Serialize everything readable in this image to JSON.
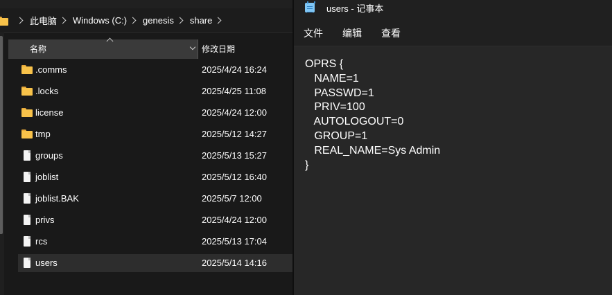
{
  "explorer": {
    "breadcrumb": [
      "此电脑",
      "Windows (C:)",
      "genesis",
      "share"
    ],
    "columns": {
      "name": "名称",
      "date": "修改日期"
    },
    "items": [
      {
        "name": ".comms",
        "date": "2025/4/24 16:24",
        "type": "folder"
      },
      {
        "name": ".locks",
        "date": "2025/4/25 11:08",
        "type": "folder"
      },
      {
        "name": "license",
        "date": "2025/4/24 12:00",
        "type": "folder"
      },
      {
        "name": "tmp",
        "date": "2025/5/12 14:27",
        "type": "folder"
      },
      {
        "name": "groups",
        "date": "2025/5/13 15:27",
        "type": "file"
      },
      {
        "name": "joblist",
        "date": "2025/5/12 16:40",
        "type": "file"
      },
      {
        "name": "joblist.BAK",
        "date": "2025/5/7 12:00",
        "type": "file"
      },
      {
        "name": "privs",
        "date": "2025/4/24 12:00",
        "type": "file"
      },
      {
        "name": "rcs",
        "date": "2025/5/13 17:04",
        "type": "file"
      },
      {
        "name": "users",
        "date": "2025/5/14 14:16",
        "type": "file",
        "selected": true
      }
    ]
  },
  "notepad": {
    "title": "users - 记事本",
    "menu": [
      "文件",
      "编辑",
      "查看"
    ],
    "content_lines": [
      "OPRS {",
      "   NAME=1",
      "   PASSWD=1",
      "   PRIV=100",
      "   AUTOLOGOUT=0",
      "   GROUP=1",
      "   REAL_NAME=Sys Admin",
      "}"
    ]
  },
  "colors": {
    "folder": "#f8c24a",
    "selected_row": "#2d2d2d",
    "header_bg": "#3a3a3a",
    "editor_bg": "#272727"
  }
}
